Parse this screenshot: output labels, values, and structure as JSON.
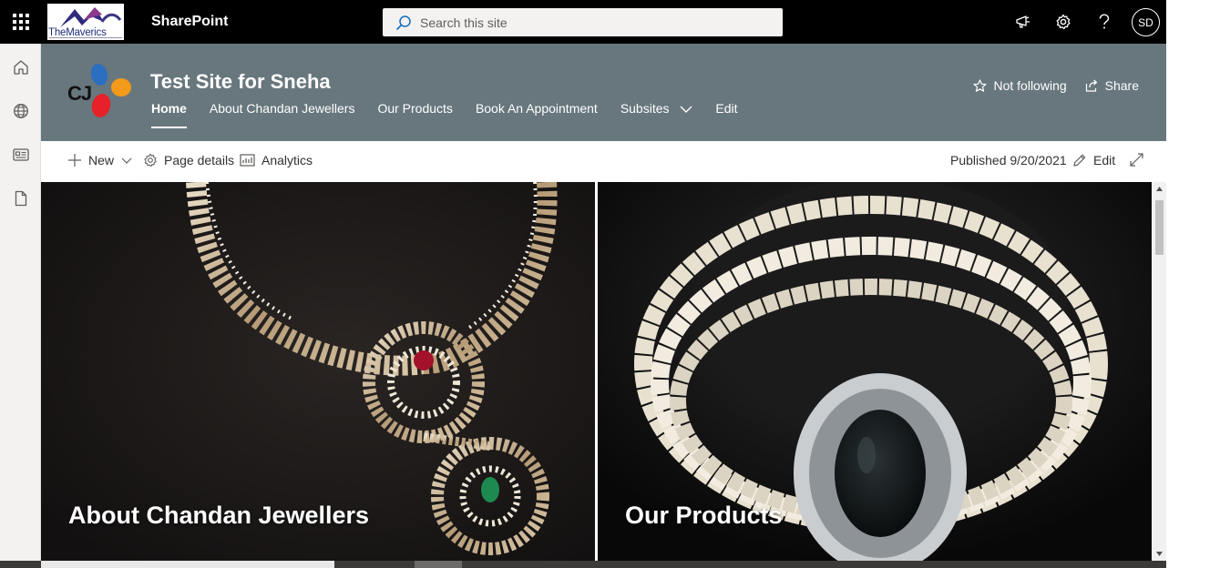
{
  "suite_bar": {
    "app_name": "SharePoint",
    "org_logo_text": "TheMaverics",
    "search_placeholder": "Search this site",
    "user_initials": "SD",
    "icons": [
      "app-launcher-icon",
      "megaphone-icon",
      "gear-icon",
      "help-icon"
    ]
  },
  "left_rail": {
    "items": [
      "home-icon",
      "globe-icon",
      "news-icon",
      "document-icon"
    ]
  },
  "site_header": {
    "logo_text": "CJ",
    "title": "Test Site for Sneha",
    "nav": [
      {
        "label": "Home",
        "active": true
      },
      {
        "label": "About Chandan Jewellers",
        "active": false
      },
      {
        "label": "Our Products",
        "active": false
      },
      {
        "label": "Book An Appointment",
        "active": false
      },
      {
        "label": "Subsites",
        "active": false,
        "has_dropdown": true
      },
      {
        "label": "Edit",
        "active": false
      }
    ],
    "follow_label": "Not following",
    "share_label": "Share",
    "colors": {
      "header_bg": "#68777d",
      "suite_bg": "#000000"
    }
  },
  "command_bar": {
    "new_label": "New",
    "page_details_label": "Page details",
    "analytics_label": "Analytics",
    "published_label": "Published 9/20/2021",
    "edit_label": "Edit"
  },
  "hero": {
    "tiles": [
      {
        "caption": "About Chandan Jewellers",
        "image": "diamond-necklace-with-ruby-and-emerald"
      },
      {
        "caption": "Our Products",
        "image": "pearl-necklace-with-black-stone-pendant"
      }
    ]
  }
}
